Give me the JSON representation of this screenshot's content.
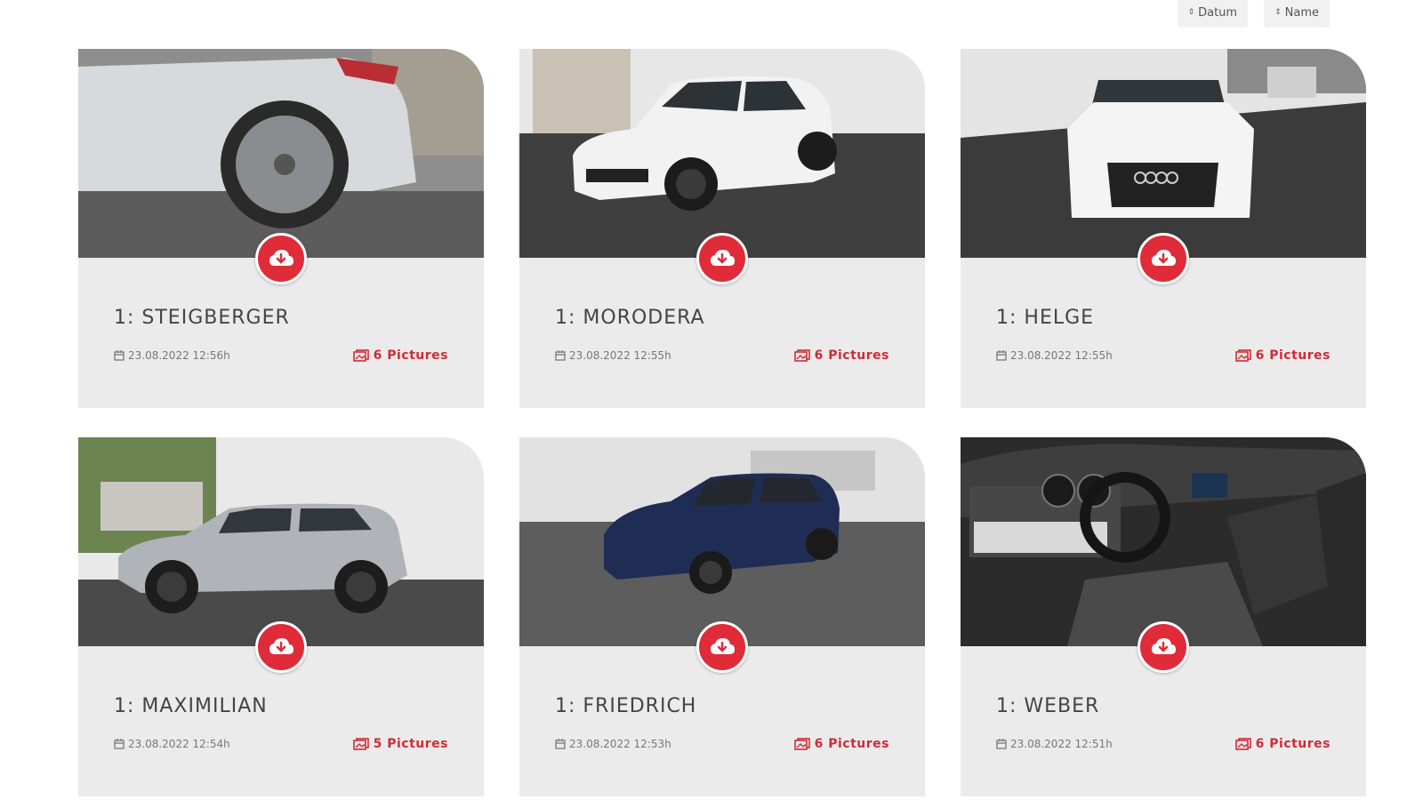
{
  "sort": {
    "date_label": "Datum",
    "name_label": "Name"
  },
  "cards": [
    {
      "title": "1: STEIGBERGER",
      "date": "23.08.2022 12:56h",
      "pictures": "6 Pictures",
      "photo": "white-audi-tt-wheel"
    },
    {
      "title": "1: MORODERA",
      "date": "23.08.2022 12:55h",
      "pictures": "6 Pictures",
      "photo": "white-vw-tiguan"
    },
    {
      "title": "1: HELGE",
      "date": "23.08.2022 12:55h",
      "pictures": "6 Pictures",
      "photo": "white-audi-a1-front"
    },
    {
      "title": "1: MAXIMILIAN",
      "date": "23.08.2022 12:54h",
      "pictures": "5 Pictures",
      "photo": "silver-honda-crv"
    },
    {
      "title": "1: FRIEDRICH",
      "date": "23.08.2022 12:53h",
      "pictures": "6 Pictures",
      "photo": "blue-vw-t-roc"
    },
    {
      "title": "1: WEBER",
      "date": "23.08.2022 12:51h",
      "pictures": "6 Pictures",
      "photo": "seat-interior-dashboard"
    }
  ],
  "icons": {
    "download": "cloud-download-icon",
    "calendar": "calendar-icon",
    "pictures": "images-icon",
    "sort": "sort-arrows-icon"
  },
  "colors": {
    "accent": "#e02b39",
    "card_bg": "#ebebeb",
    "sort_bg": "#f1f1f1"
  }
}
